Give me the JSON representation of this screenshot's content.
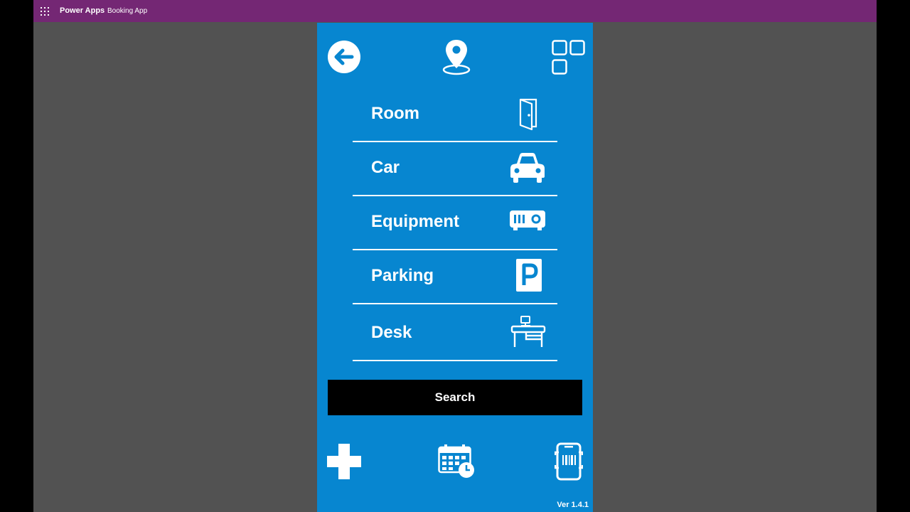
{
  "topbar": {
    "brand": "Power Apps",
    "app_name": "Booking App",
    "color": "#742774"
  },
  "screen": {
    "background_color": "#0786d0"
  },
  "header_icons": {
    "back": "arrow-left-icon",
    "location": "map-pin-icon",
    "apps": "app-grid-icon"
  },
  "menu": [
    {
      "label": "Room",
      "icon": "door-icon"
    },
    {
      "label": "Car",
      "icon": "car-icon"
    },
    {
      "label": "Equipment",
      "icon": "projector-icon"
    },
    {
      "label": "Parking",
      "icon": "parking-icon"
    },
    {
      "label": "Desk",
      "icon": "desk-icon"
    }
  ],
  "search_button": {
    "label": "Search"
  },
  "footer_icons": {
    "add": "plus-icon",
    "calendar": "calendar-clock-icon",
    "scan": "phone-scan-icon"
  },
  "version": "Ver 1.4.1"
}
